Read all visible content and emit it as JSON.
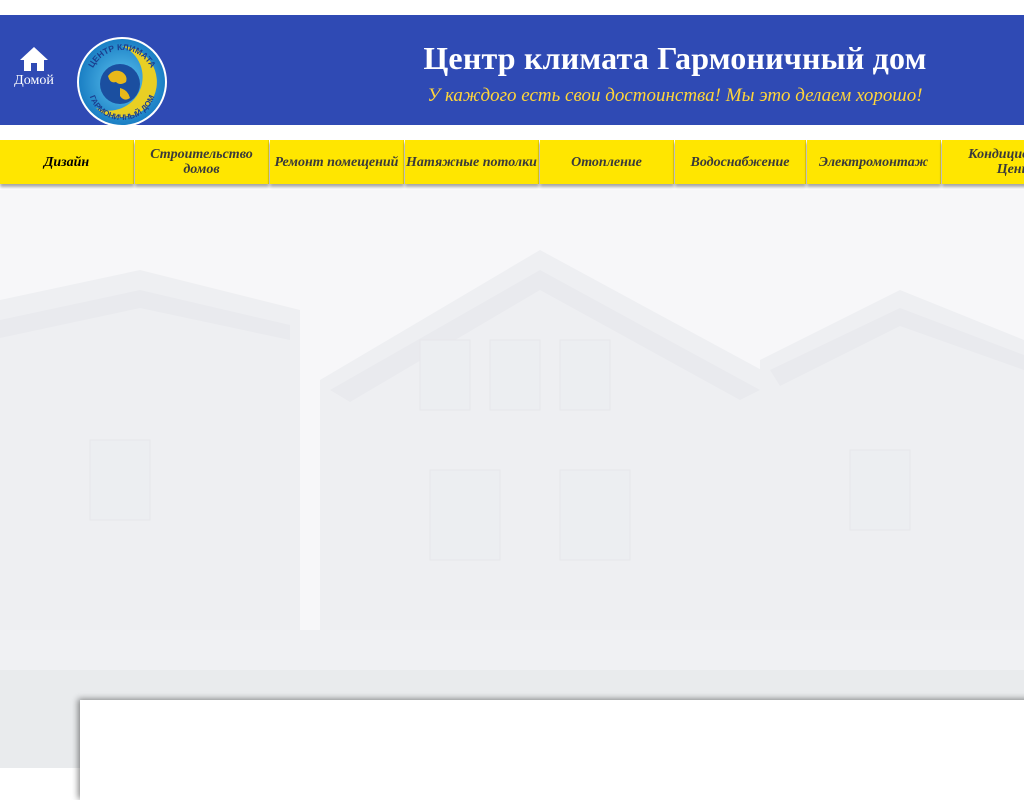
{
  "header": {
    "home_label": "Домой",
    "home_icon": "home-icon",
    "logo_icon": "globe-logo-icon",
    "logo_text_top": "ЦЕНТР КЛИМАТА",
    "logo_text_bottom": "ГАРМОНИЧНЫЙ ДОМ",
    "title": "Центр климата Гармоничный дом",
    "slogan": "У каждого есть свои достоинства! Мы это делаем хорошо!"
  },
  "nav": {
    "items": [
      {
        "label": "Дизайн",
        "active": true
      },
      {
        "label": "Строительство домов",
        "active": false
      },
      {
        "label": "Ремонт помещений",
        "active": false
      },
      {
        "label": "Натяжные потолки",
        "active": false
      },
      {
        "label": "Отопление",
        "active": false
      },
      {
        "label": "Водоснабжение",
        "active": false
      },
      {
        "label": "Электромонтаж",
        "active": false
      },
      {
        "label": "Кондиционеры Цены",
        "active": false
      }
    ]
  },
  "colors": {
    "header_bg": "#2f4ab4",
    "slogan": "#ffd53a",
    "nav_bg": "#ffe600",
    "content_bg": "#e9ebed"
  }
}
